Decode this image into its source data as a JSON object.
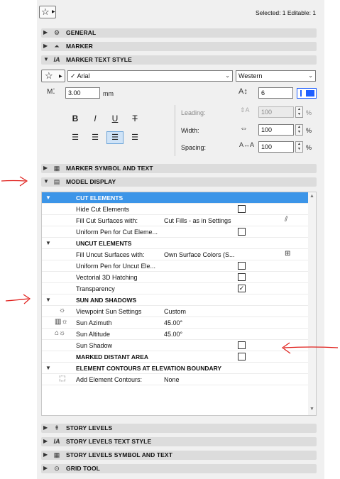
{
  "header": {
    "favorite_icon": "star-icon",
    "selection_info": "Selected: 1 Editable: 1"
  },
  "sections_top": [
    {
      "label": "GENERAL",
      "expanded": false,
      "icon": "general-settings-icon"
    },
    {
      "label": "MARKER",
      "expanded": false,
      "icon": "marker-icon"
    },
    {
      "label": "MARKER TEXT STYLE",
      "expanded": true,
      "icon": "text-style-icon"
    }
  ],
  "text_style": {
    "font_name": "Arial",
    "font_check": "✓",
    "script": "Western",
    "width_value": "3.00",
    "width_unit": "mm",
    "height_value": "6",
    "bold_label": "B",
    "italic_label": "I",
    "underline_label": "U",
    "strike_label": "T",
    "leading_label": "Leading:",
    "leading_value": "100",
    "leading_unit": "%",
    "width_label": "Width:",
    "width_pct_value": "100",
    "width_pct_unit": "%",
    "spacing_label": "Spacing:",
    "spacing_value": "100",
    "spacing_unit": "%"
  },
  "sections_mid": [
    {
      "label": "MARKER SYMBOL AND TEXT",
      "expanded": false,
      "icon": "symbol-text-icon"
    },
    {
      "label": "MODEL DISPLAY",
      "expanded": true,
      "icon": "model-display-icon"
    }
  ],
  "tree": {
    "rows": [
      {
        "type": "header",
        "label": "CUT ELEMENTS",
        "selected": true
      },
      {
        "type": "item",
        "label": "Hide Cut Elements",
        "checkbox": ""
      },
      {
        "type": "item",
        "label": "Fill Cut Surfaces with:",
        "value": "Cut Fills - as in Settings",
        "icon": "fill-icon"
      },
      {
        "type": "item",
        "label": "Uniform Pen for Cut Eleme...",
        "checkbox": ""
      },
      {
        "type": "header",
        "label": "UNCUT ELEMENTS"
      },
      {
        "type": "item",
        "label": "Fill Uncut Surfaces with:",
        "value": "Own Surface Colors (S...",
        "icon": "surface-icon"
      },
      {
        "type": "item",
        "label": "Uniform Pen for Uncut Ele...",
        "checkbox": ""
      },
      {
        "type": "item",
        "label": "Vectorial 3D Hatching",
        "checkbox": ""
      },
      {
        "type": "item",
        "label": "Transparency",
        "checkbox": "✓"
      },
      {
        "type": "header",
        "label": "SUN AND SHADOWS"
      },
      {
        "type": "item",
        "label": "Viewpoint Sun Settings",
        "value": "Custom",
        "icon": "sun-icon"
      },
      {
        "type": "item",
        "label": "Sun Azimuth",
        "value": "45.00°",
        "icon": "azimuth-icon"
      },
      {
        "type": "item",
        "label": "Sun Altitude",
        "value": "45.00°",
        "icon": "altitude-icon"
      },
      {
        "type": "item",
        "label": "Sun Shadow",
        "checkbox": ""
      },
      {
        "type": "plain",
        "label": "MARKED DISTANT AREA",
        "checkbox": ""
      },
      {
        "type": "header",
        "label": "ELEMENT CONTOURS AT ELEVATION BOUNDARY"
      },
      {
        "type": "item",
        "label": "Add Element Contours:",
        "value": "None",
        "icon": "contour-icon"
      }
    ]
  },
  "sections_bottom": [
    {
      "label": "STORY LEVELS",
      "expanded": false,
      "icon": "story-levels-icon"
    },
    {
      "label": "STORY LEVELS TEXT STYLE",
      "expanded": false,
      "icon": "text-style-icon"
    },
    {
      "label": "STORY LEVELS SYMBOL AND TEXT",
      "expanded": false,
      "icon": "symbol-text-icon"
    },
    {
      "label": "GRID TOOL",
      "expanded": false,
      "icon": "grid-tool-icon"
    }
  ],
  "colors": {
    "selection_blue": "#3c95e8",
    "annotation_red": "#e0201c",
    "accent_button": "#1f5fff"
  }
}
